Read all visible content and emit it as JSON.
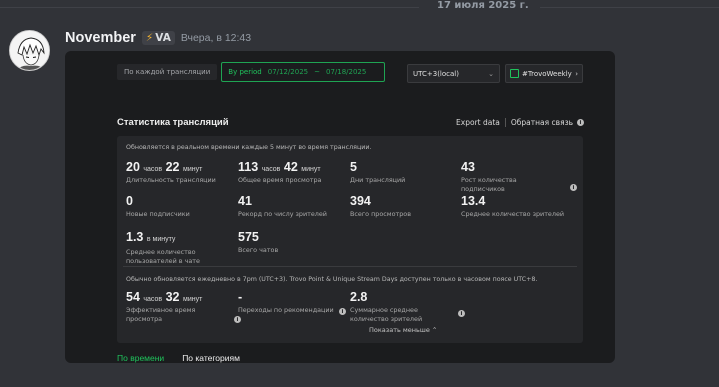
{
  "date_divider": "17 июля 2025 г.",
  "message": {
    "username": "November",
    "tag": "VA",
    "timestamp": "Вчера, в 12:43"
  },
  "toolbar": {
    "per_stream": "По каждой трансляции",
    "by_period": "By period",
    "date_from": "07/12/2025",
    "date_sep": "~",
    "date_to": "07/18/2025",
    "timezone": "UTC+3(local)",
    "tag_button": "#TrovoWeekly"
  },
  "section": {
    "title": "Статистика трансляций",
    "export": "Export data",
    "feedback": "Обратная связь"
  },
  "realtime_note": "Обновляется в реальном времени каждые 5 минут во время трансляции.",
  "stats": {
    "duration": {
      "v1": "20",
      "u1": "часов",
      "v2": "22",
      "u2": "минут",
      "label": "Длительность трансляции"
    },
    "watch_time": {
      "v1": "113",
      "u1": "часов",
      "v2": "42",
      "u2": "минут",
      "label": "Общее время просмотра"
    },
    "stream_days": {
      "value": "5",
      "label": "Дни трансляций"
    },
    "follower_growth": {
      "value": "43",
      "label": "Рост количества подписчиков"
    },
    "new_followers": {
      "value": "0",
      "label": "Новые подписчики"
    },
    "peak_viewers": {
      "value": "41",
      "label": "Рекорд по числу зрителей"
    },
    "total_views": {
      "value": "394",
      "label": "Всего просмотров"
    },
    "avg_viewers": {
      "value": "13.4",
      "label": "Среднее количество зрителей"
    },
    "chatters_per_min": {
      "value": "1.3",
      "unit": "в минуту",
      "label": "Среднее количество пользователей в чате"
    },
    "total_chats": {
      "value": "575",
      "label": "Всего чатов"
    }
  },
  "daily_note": "Обычно обновляется ежедневно в 7pm (UTC+3). Trovo Point & Unique Stream Days доступен только в часовом поясе UTC+8.",
  "daily_stats": {
    "effective_watch": {
      "v1": "54",
      "u1": "часов",
      "v2": "32",
      "u2": "минут",
      "label": "Эффективное время просмотра"
    },
    "recommend_clicks": {
      "value": "-",
      "label": "Переходы по рекомендации"
    },
    "avg_total_viewers": {
      "value": "2.8",
      "label": "Суммарное среднее количество зрителей"
    }
  },
  "show_less": "Показать меньше ⌃",
  "tabs": {
    "by_time": "По времени",
    "by_category": "По категориям"
  }
}
